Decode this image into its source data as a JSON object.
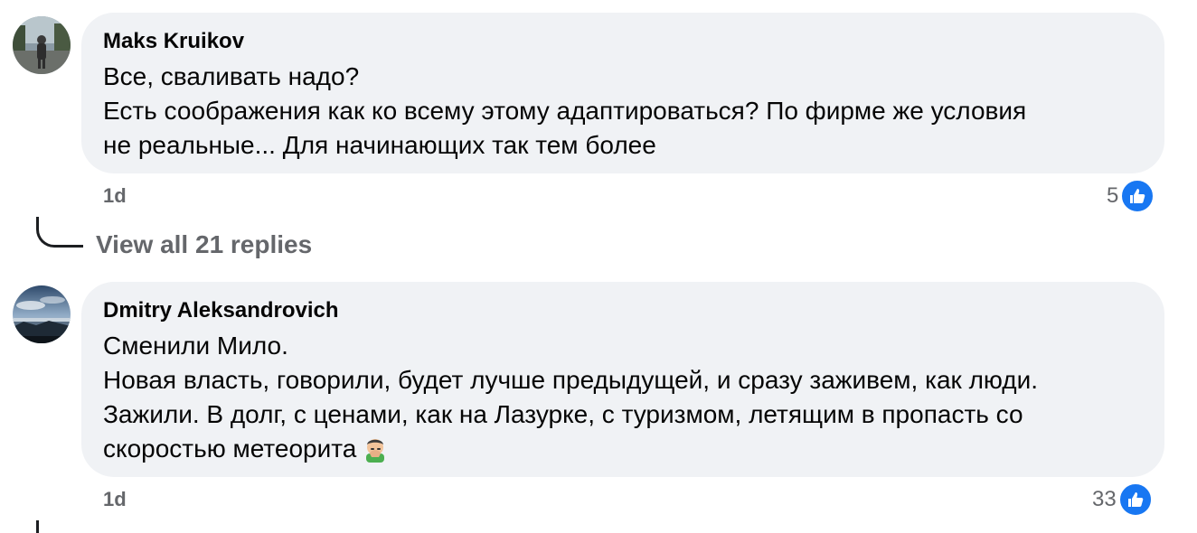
{
  "comments": [
    {
      "author": "Maks Kruikov",
      "lines": [
        "Все, сваливать надо?",
        "Есть соображения как ко всему этому адаптироваться? По фирме же условия",
        "не реальные... Для начинающих так тем более"
      ],
      "time": "1d",
      "reaction_count": "5",
      "avatar_icon": "person-walking-photo",
      "reaction_icon": "like-thumb-icon"
    },
    {
      "author": "Dmitry Aleksandrovich",
      "lines": [
        "Сменили Мило.",
        "Новая власть, говорили, будет лучше предыдущей, и сразу заживем, как люди.",
        "Зажили. В долг, с ценами, как на Лазурке, с туризмом, летящим в пропасть со",
        "скоростью метеорита"
      ],
      "emoji": "face-palm-emoji",
      "time": "1d",
      "reaction_count": "33",
      "avatar_icon": "seascape-photo",
      "reaction_icon": "like-thumb-icon"
    }
  ],
  "replies_link": "View all 21 replies",
  "colors": {
    "bubble_bg": "#f0f2f5",
    "secondary_text": "#65676b",
    "like_blue": "#1877f2"
  }
}
